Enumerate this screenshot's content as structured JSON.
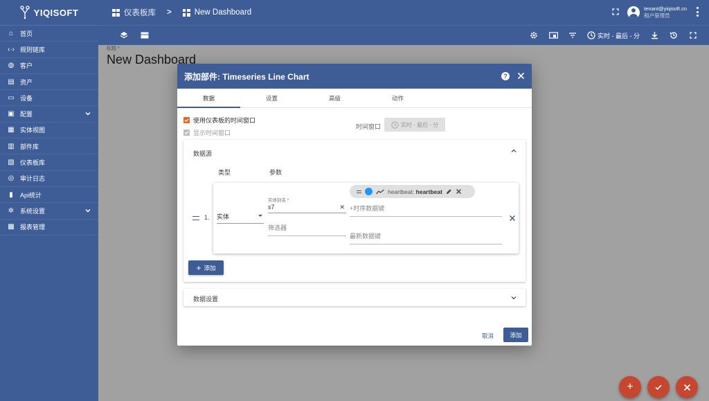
{
  "brand": {
    "name": "YIQISOFT"
  },
  "sidebar": {
    "items": [
      {
        "label": "首页",
        "icon": "home-icon"
      },
      {
        "label": "规则链库",
        "icon": "code-icon"
      },
      {
        "label": "客户",
        "icon": "customers-icon"
      },
      {
        "label": "资产",
        "icon": "assets-icon"
      },
      {
        "label": "设备",
        "icon": "devices-icon"
      },
      {
        "label": "配置",
        "icon": "config-icon",
        "expandable": true
      },
      {
        "label": "实体视图",
        "icon": "entity-view-icon"
      },
      {
        "label": "部件库",
        "icon": "widgets-icon"
      },
      {
        "label": "仪表板库",
        "icon": "dashboards-icon"
      },
      {
        "label": "审计日志",
        "icon": "audit-icon"
      },
      {
        "label": "Api统计",
        "icon": "api-stats-icon"
      },
      {
        "label": "系统设置",
        "icon": "settings-icon",
        "expandable": true
      },
      {
        "label": "报表管理",
        "icon": "report-icon"
      }
    ]
  },
  "breadcrumb": {
    "parent": "仪表板库",
    "separator": ">",
    "current": "New Dashboard"
  },
  "user": {
    "email": "tenant@yiqisoft.cn",
    "role": "租户管理员"
  },
  "toolbar": {
    "timewindow": "实时 - 最后 - 分"
  },
  "main": {
    "title_label": "标题 *",
    "title": "New Dashboard"
  },
  "dialog": {
    "title": "添加部件: Timeseries Line Chart",
    "help": "?",
    "tabs": [
      "数据",
      "设置",
      "高级",
      "动作"
    ],
    "use_dashboard_timewindow": "使用仪表板的时间窗口",
    "show_timewindow": "显示时间窗口",
    "timewindow_label": "时间窗口",
    "timewindow_value": "实时 - 最后 - 分",
    "datasource": {
      "title": "数据源",
      "col_type": "类型",
      "col_params": "参数",
      "index": "1.",
      "type_value": "实体",
      "alias_label": "实体别名 *",
      "alias_value": "s7",
      "filter_placeholder": "筛选器",
      "key_chip_label": "heartbeat:",
      "key_chip_value": "heartbeat",
      "ts_key_placeholder": "+时序数据键",
      "latest_key_placeholder": "最新数据键",
      "add_label": "添加"
    },
    "data_settings": "数据设置",
    "cancel": "取消",
    "add": "添加"
  },
  "colors": {
    "primary": "#3e5d96",
    "accent": "#e4652d",
    "fab": "#c6462f",
    "chip_dot": "#2196f3"
  }
}
